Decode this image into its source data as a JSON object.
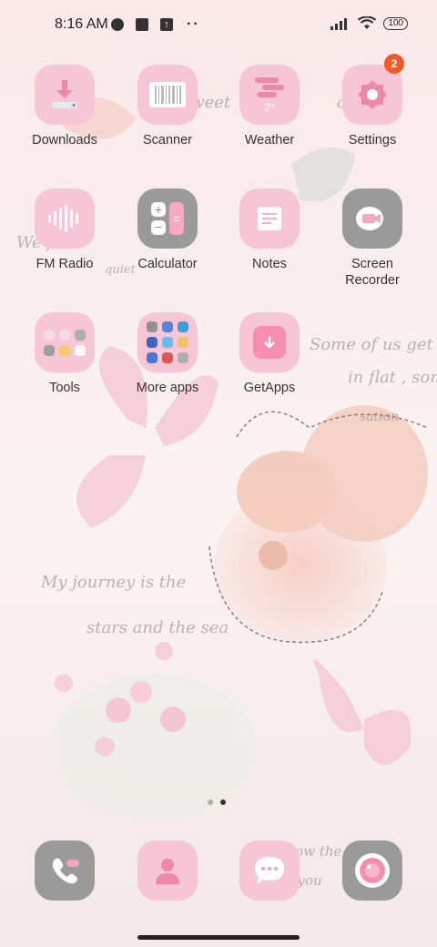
{
  "status_bar": {
    "time": "8:16 AM",
    "battery": "100",
    "notif_more": "··"
  },
  "apps": [
    {
      "label": "Downloads",
      "icon": "download-icon",
      "badge": ""
    },
    {
      "label": "Scanner",
      "icon": "barcode-icon",
      "badge": ""
    },
    {
      "label": "Weather",
      "icon": "weather-icon",
      "badge": "",
      "temp": "2°"
    },
    {
      "label": "Settings",
      "icon": "gear-icon",
      "badge": "2"
    },
    {
      "label": "FM Radio",
      "icon": "radio-wave-icon",
      "badge": ""
    },
    {
      "label": "Calculator",
      "icon": "calculator-icon",
      "badge": ""
    },
    {
      "label": "Notes",
      "icon": "notes-icon",
      "badge": ""
    },
    {
      "label": "Screen\nRecorder",
      "icon": "video-camera-icon",
      "badge": ""
    },
    {
      "label": "Tools",
      "icon": "folder-icon",
      "badge": ""
    },
    {
      "label": "More apps",
      "icon": "folder-icon",
      "badge": ""
    },
    {
      "label": "GetApps",
      "icon": "getapps-icon",
      "badge": ""
    }
  ],
  "dock": [
    {
      "name": "phone",
      "icon": "phone-icon"
    },
    {
      "name": "contacts",
      "icon": "contacts-icon"
    },
    {
      "name": "messages",
      "icon": "message-icon"
    },
    {
      "name": "camera",
      "icon": "camera-icon"
    }
  ],
  "page_indicator": {
    "pages": 2,
    "current": 2
  },
  "wallpaper_text": [
    "sweet",
    "ake the",
    "We fall i",
    "quiet",
    "Some of us get",
    "in flat , som",
    "sation",
    "My journey is the",
    "stars and the sea",
    "follow the light",
    "for you"
  ]
}
